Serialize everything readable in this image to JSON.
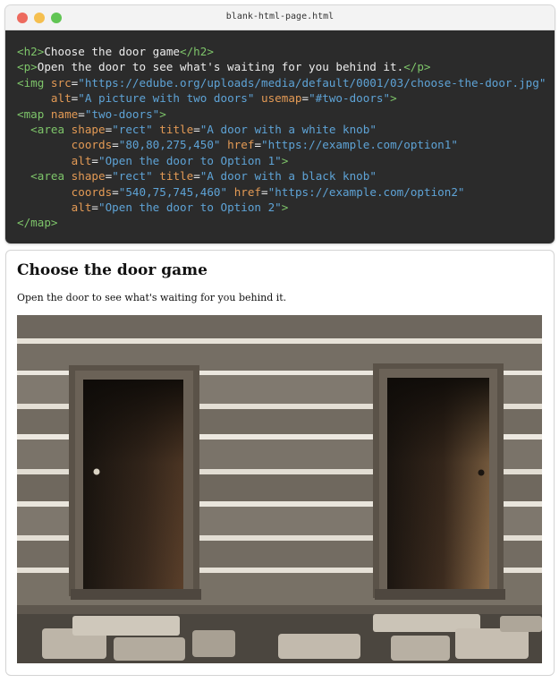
{
  "window": {
    "title": "blank-html-page.html",
    "buttons": [
      "close",
      "minimize",
      "zoom"
    ]
  },
  "code_lines": [
    [
      {
        "t": "tag",
        "v": "<h2>"
      },
      {
        "t": "txt",
        "v": "Choose the door game"
      },
      {
        "t": "tag",
        "v": "</h2>"
      }
    ],
    [
      {
        "t": "tag",
        "v": "<p>"
      },
      {
        "t": "txt",
        "v": "Open the door to see what's waiting for you behind it."
      },
      {
        "t": "tag",
        "v": "</p>"
      }
    ],
    [
      {
        "t": "tag",
        "v": "<img "
      },
      {
        "t": "attr",
        "v": "src"
      },
      {
        "t": "txt",
        "v": "="
      },
      {
        "t": "val",
        "v": "\"https://edube.org/uploads/media/default/0001/03/choose-the-door.jpg\""
      }
    ],
    [
      {
        "t": "txt",
        "v": "     "
      },
      {
        "t": "attr",
        "v": "alt"
      },
      {
        "t": "txt",
        "v": "="
      },
      {
        "t": "val",
        "v": "\"A picture with two doors\""
      },
      {
        "t": "txt",
        "v": " "
      },
      {
        "t": "attr",
        "v": "usemap"
      },
      {
        "t": "txt",
        "v": "="
      },
      {
        "t": "val",
        "v": "\"#two-doors\""
      },
      {
        "t": "tag",
        "v": ">"
      }
    ],
    [
      {
        "t": "tag",
        "v": "<map "
      },
      {
        "t": "attr",
        "v": "name"
      },
      {
        "t": "txt",
        "v": "="
      },
      {
        "t": "val",
        "v": "\"two-doors\""
      },
      {
        "t": "tag",
        "v": ">"
      }
    ],
    [
      {
        "t": "txt",
        "v": "  "
      },
      {
        "t": "tag",
        "v": "<area "
      },
      {
        "t": "attr",
        "v": "shape"
      },
      {
        "t": "txt",
        "v": "="
      },
      {
        "t": "val",
        "v": "\"rect\""
      },
      {
        "t": "txt",
        "v": " "
      },
      {
        "t": "attr",
        "v": "title"
      },
      {
        "t": "txt",
        "v": "="
      },
      {
        "t": "val",
        "v": "\"A door with a white knob\""
      }
    ],
    [
      {
        "t": "txt",
        "v": "        "
      },
      {
        "t": "attr",
        "v": "coords"
      },
      {
        "t": "txt",
        "v": "="
      },
      {
        "t": "val",
        "v": "\"80,80,275,450\""
      },
      {
        "t": "txt",
        "v": " "
      },
      {
        "t": "attr",
        "v": "href"
      },
      {
        "t": "txt",
        "v": "="
      },
      {
        "t": "val",
        "v": "\"https://example.com/option1\""
      }
    ],
    [
      {
        "t": "txt",
        "v": "        "
      },
      {
        "t": "attr",
        "v": "alt"
      },
      {
        "t": "txt",
        "v": "="
      },
      {
        "t": "val",
        "v": "\"Open the door to Option 1\""
      },
      {
        "t": "tag",
        "v": ">"
      }
    ],
    [
      {
        "t": "txt",
        "v": "  "
      },
      {
        "t": "tag",
        "v": "<area "
      },
      {
        "t": "attr",
        "v": "shape"
      },
      {
        "t": "txt",
        "v": "="
      },
      {
        "t": "val",
        "v": "\"rect\""
      },
      {
        "t": "txt",
        "v": " "
      },
      {
        "t": "attr",
        "v": "title"
      },
      {
        "t": "txt",
        "v": "="
      },
      {
        "t": "val",
        "v": "\"A door with a black knob\""
      }
    ],
    [
      {
        "t": "txt",
        "v": "        "
      },
      {
        "t": "attr",
        "v": "coords"
      },
      {
        "t": "txt",
        "v": "="
      },
      {
        "t": "val",
        "v": "\"540,75,745,460\""
      },
      {
        "t": "txt",
        "v": " "
      },
      {
        "t": "attr",
        "v": "href"
      },
      {
        "t": "txt",
        "v": "="
      },
      {
        "t": "val",
        "v": "\"https://example.com/option2\""
      }
    ],
    [
      {
        "t": "txt",
        "v": "        "
      },
      {
        "t": "attr",
        "v": "alt"
      },
      {
        "t": "txt",
        "v": "="
      },
      {
        "t": "val",
        "v": "\"Open the door to Option 2\""
      },
      {
        "t": "tag",
        "v": ">"
      }
    ],
    [
      {
        "t": "tag",
        "v": "</map>"
      }
    ]
  ],
  "preview": {
    "heading": "Choose the door game",
    "paragraph": "Open the door to see what's waiting for you behind it."
  },
  "colors": {
    "code_bg": "#2b2b2b",
    "tag": "#7ec56a",
    "attr": "#e39a55",
    "value": "#5ea3d6",
    "text": "#ececec"
  },
  "icons": [
    "close-dot-icon",
    "minimize-dot-icon",
    "zoom-dot-icon"
  ]
}
